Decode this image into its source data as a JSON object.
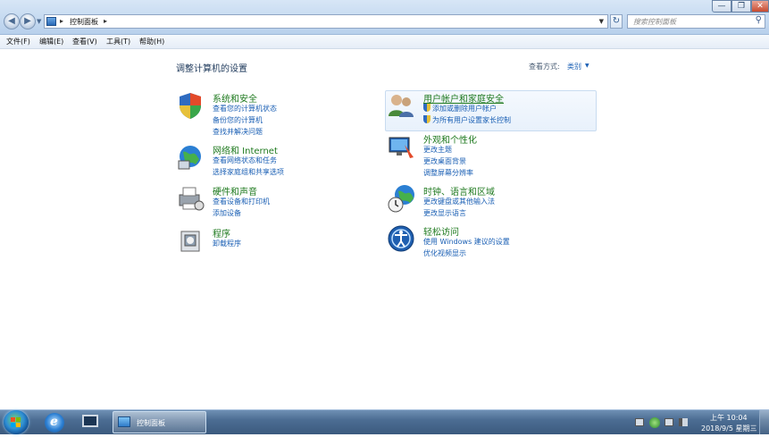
{
  "window": {
    "breadcrumb": [
      "控制面板"
    ],
    "search_placeholder": "搜索控制面板",
    "min_glyph": "—",
    "max_glyph": "❐",
    "close_glyph": "✕"
  },
  "menu": [
    "文件(F)",
    "编辑(E)",
    "查看(V)",
    "工具(T)",
    "帮助(H)"
  ],
  "main": {
    "title": "调整计算机的设置",
    "view_by_label": "查看方式:",
    "view_by_value": "类别"
  },
  "categories": [
    {
      "title": "系统和安全",
      "links": [
        "查看您的计算机状态",
        "备份您的计算机",
        "查找并解决问题"
      ],
      "icon": "shield-icon"
    },
    {
      "title": "网络和 Internet",
      "links": [
        "查看网络状态和任务",
        "选择家庭组和共享选项"
      ],
      "icon": "network-globe-icon"
    },
    {
      "title": "硬件和声音",
      "links": [
        "查看设备和打印机",
        "添加设备"
      ],
      "icon": "printer-icon"
    },
    {
      "title": "程序",
      "links": [
        "卸载程序"
      ],
      "icon": "programs-icon"
    },
    {
      "title": "用户帐户和家庭安全",
      "links": [
        "添加或删除用户帐户",
        "为所有用户设置家长控制"
      ],
      "icon": "users-icon"
    },
    {
      "title": "外观和个性化",
      "links": [
        "更改主题",
        "更改桌面背景",
        "调整屏幕分辨率"
      ],
      "icon": "appearance-icon"
    },
    {
      "title": "时钟、语言和区域",
      "links": [
        "更改键盘或其他输入法",
        "更改显示语言"
      ],
      "icon": "clock-globe-icon"
    },
    {
      "title": "轻松访问",
      "links": [
        "使用 Windows 建议的设置",
        "优化视频显示"
      ],
      "icon": "ease-of-access-icon"
    }
  ],
  "taskbar": {
    "active_window": "控制面板",
    "time": "上午 10:04",
    "date": "2018/9/5 星期三"
  }
}
